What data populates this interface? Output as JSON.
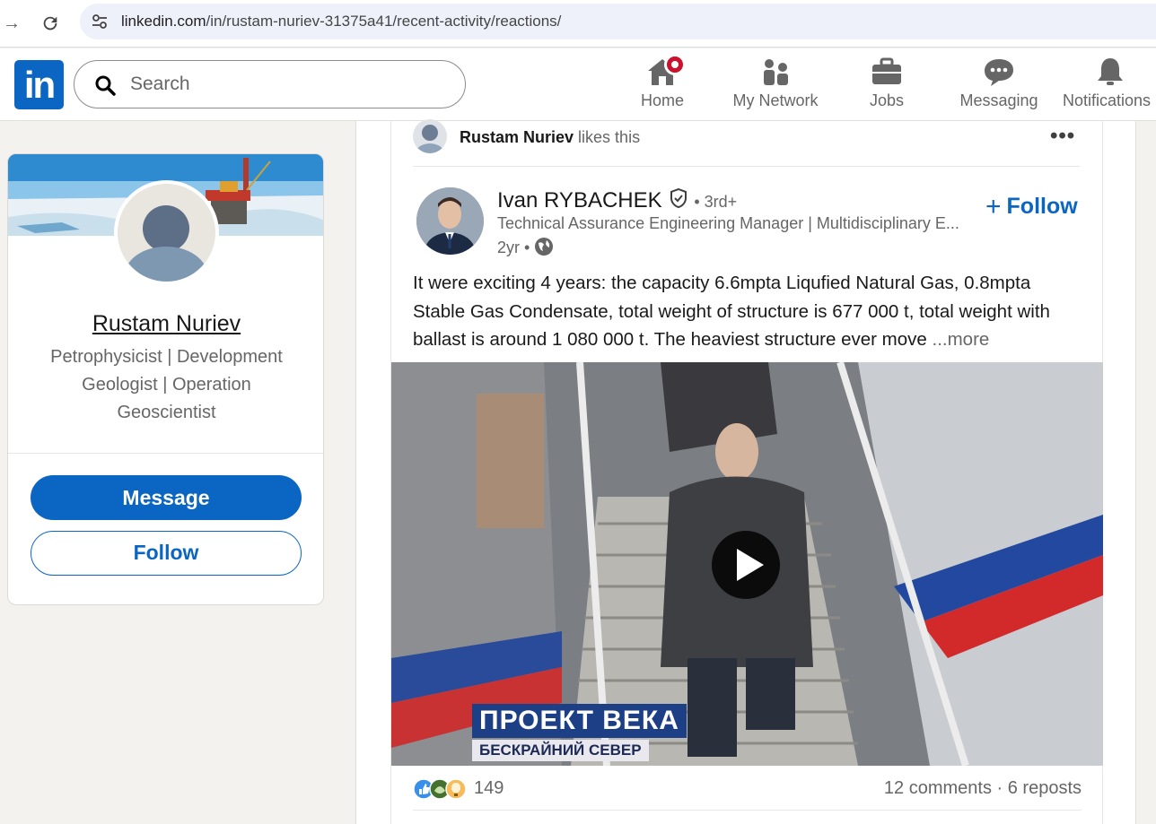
{
  "browser": {
    "url_domain": "linkedin.com",
    "url_path": "/in/rustam-nuriev-31375a41/recent-activity/reactions/"
  },
  "header": {
    "logo_text": "in",
    "search_placeholder": "Search",
    "nav": [
      {
        "label": "Home",
        "icon": "home-icon",
        "has_badge": true
      },
      {
        "label": "My Network",
        "icon": "network-icon"
      },
      {
        "label": "Jobs",
        "icon": "briefcase-icon"
      },
      {
        "label": "Messaging",
        "icon": "messaging-icon"
      },
      {
        "label": "Notifications",
        "icon": "bell-icon"
      }
    ]
  },
  "profile_card": {
    "name": "Rustam Nuriev",
    "headline": "Petrophysicist | Development Geologist | Operation Geoscientist",
    "message_label": "Message",
    "follow_label": "Follow"
  },
  "post": {
    "context_actor": "Rustam Nuriev",
    "context_action": " likes this",
    "author_name": "Ivan RYBACHEK",
    "author_degree": " • 3rd+",
    "author_title": "Technical Assurance Engineering Manager | Multidisciplinary E...",
    "author_time": "2yr • ",
    "follow_label": "Follow",
    "text": "It were exciting 4 years:  the capacity 6.6mpta Liqufied Natural Gas, 0.8mpta Stable Gas Condensate, total weight of structure is 677 000 t, total weight with ballast is around 1 080 000 t. The heaviest structure ever move ",
    "see_more": "...more",
    "video_caption_main": "ПРОЕКТ ВЕКА",
    "video_caption_sub": "БЕСКРАЙНИЙ СЕВЕР",
    "reaction_count": "149",
    "comments_reposts": "12 comments · 6 reposts"
  },
  "colors": {
    "brand": "#0a66c2",
    "badge": "#cb112d",
    "page_bg": "#f4f2ee"
  }
}
